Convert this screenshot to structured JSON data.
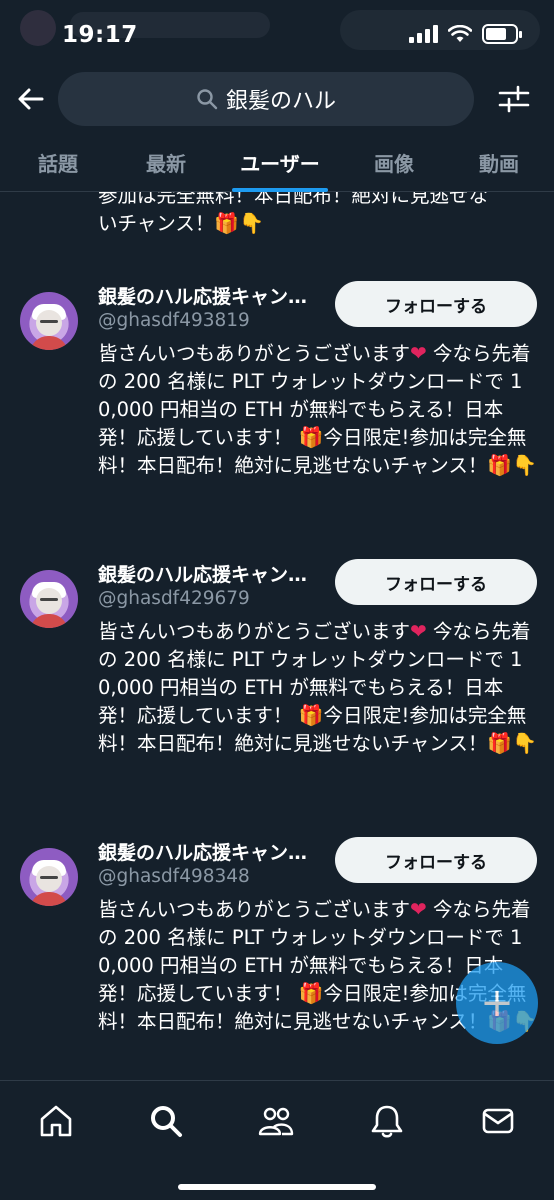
{
  "status": {
    "time": "19:17"
  },
  "search": {
    "query": "銀髪のハル"
  },
  "tabs": [
    {
      "label": "話題",
      "active": false
    },
    {
      "label": "最新",
      "active": false
    },
    {
      "label": "ユーザー",
      "active": true
    },
    {
      "label": "画像",
      "active": false
    },
    {
      "label": "動画",
      "active": false
    }
  ],
  "partial_post": {
    "line1": "参加は完全無料！本日配布！絶対に見逃せな",
    "line2": "いチャンス！"
  },
  "posts": [
    {
      "name": "銀髪のハル応援キャン…",
      "handle": "@ghasdf493819",
      "follow_label": "フォローする",
      "text_a": "皆さんいつもありがとうございます",
      "text_b": " 今なら先着の 200 名様に PLT ウォレットダウンロードで 10,000 円相当の ETH が無料でもらえる！日本発！応援しています！ ",
      "text_c": "今日限定!参加は完全無料！本日配布！絶対に見逃せないチャンス！"
    },
    {
      "name": "銀髪のハル応援キャン…",
      "handle": "@ghasdf429679",
      "follow_label": "フォローする",
      "text_a": "皆さんいつもありがとうございます",
      "text_b": " 今なら先着の 200 名様に PLT ウォレットダウンロードで 10,000 円相当の ETH が無料でもらえる！日本発！応援しています！ ",
      "text_c": "今日限定!参加は完全無料！本日配布！絶対に見逃せないチャンス！"
    },
    {
      "name": "銀髪のハル応援キャン…",
      "handle": "@ghasdf498348",
      "follow_label": "フォローする",
      "text_a": "皆さんいつもありがとうございます",
      "text_b": " 今なら先着の 200 名様に PLT ウォレットダウンロードで 10,000 円相当の ETH が無料でもらえる！日本発！応援しています！ ",
      "text_c": "今日限定!参加は完全無料！本日配布！絶対に見逃せないチャンス！"
    }
  ],
  "colors": {
    "accent": "#1d9bf0",
    "background": "#15202b",
    "muted": "#8b98a5",
    "heart": "#e0245e"
  },
  "icons": {
    "back": "arrow-left-icon",
    "search": "search-icon",
    "filter": "sliders-icon",
    "nav": [
      "home-icon",
      "search-icon",
      "communities-icon",
      "bell-icon",
      "mail-icon"
    ],
    "fab": "plus-icon"
  }
}
